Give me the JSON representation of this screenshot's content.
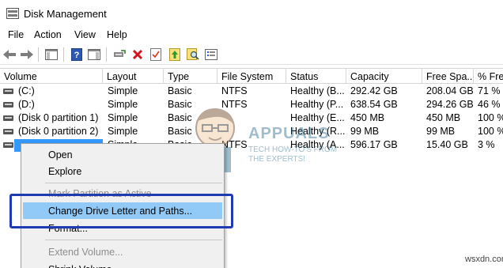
{
  "window": {
    "title": "Disk Management",
    "icon": "disk-management-icon"
  },
  "menu": [
    "File",
    "Action",
    "View",
    "Help"
  ],
  "toolbar": {
    "icons": [
      "back-arrow-icon",
      "forward-arrow-icon",
      "console-tree-icon",
      "help-icon",
      "properties-icon",
      "connect-icon",
      "delete-icon",
      "checklist-icon",
      "up-icon",
      "search-icon",
      "list-icon"
    ]
  },
  "table": {
    "headers": [
      "Volume",
      "Layout",
      "Type",
      "File System",
      "Status",
      "Capacity",
      "Free Spa...",
      "% Free"
    ],
    "rows": [
      {
        "volume": "(C:)",
        "layout": "Simple",
        "type": "Basic",
        "fs": "NTFS",
        "status": "Healthy (B...",
        "capacity": "292.42 GB",
        "free": "208.04 GB",
        "pct": "71 %"
      },
      {
        "volume": "(D:)",
        "layout": "Simple",
        "type": "Basic",
        "fs": "NTFS",
        "status": "Healthy (P...",
        "capacity": "638.54 GB",
        "free": "294.26 GB",
        "pct": "46 %"
      },
      {
        "volume": "(Disk 0 partition 1)",
        "layout": "Simple",
        "type": "Basic",
        "fs": "",
        "status": "Healthy (E...",
        "capacity": "450 MB",
        "free": "450 MB",
        "pct": "100 %"
      },
      {
        "volume": "(Disk 0 partition 2)",
        "layout": "Simple",
        "type": "Basic",
        "fs": "",
        "status": "Healthy (R...",
        "capacity": "99 MB",
        "free": "99 MB",
        "pct": "100 %"
      },
      {
        "volume": "",
        "layout": "Simple",
        "type": "Basic",
        "fs": "NTFS",
        "status": "Healthy (A...",
        "capacity": "596.17 GB",
        "free": "15.40 GB",
        "pct": "3 %"
      }
    ]
  },
  "context_menu": {
    "items": [
      {
        "label": "Open",
        "disabled": false
      },
      {
        "label": "Explore",
        "disabled": false
      },
      {
        "label": "Mark Partition as Active",
        "disabled": true
      },
      {
        "label": "Change Drive Letter and Paths...",
        "disabled": false,
        "highlighted": true
      },
      {
        "label": "Format...",
        "disabled": false
      },
      {
        "label": "Extend Volume...",
        "disabled": true
      },
      {
        "label": "Shrink Volume...",
        "disabled": false
      }
    ]
  },
  "watermark": {
    "brand": "APPUALS",
    "line1": "TECH HOW-TO'S FROM",
    "line2": "THE EXPERTS!"
  },
  "source_mark": "wsxdn.com",
  "colors": {
    "highlight_fill": "#91c9f7",
    "highlight_box": "#1f3bb3",
    "selection": "#3399ff"
  }
}
